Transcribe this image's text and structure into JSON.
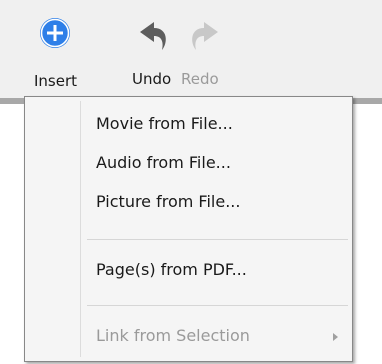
{
  "toolbar": {
    "insert": {
      "label": "Insert",
      "icon": "plus-circle-icon"
    },
    "undo": {
      "label": "Undo",
      "icon": "undo-icon"
    },
    "redo": {
      "label": "Redo",
      "icon": "redo-icon",
      "disabled": true
    }
  },
  "insert_menu": {
    "items": [
      {
        "label": "Movie from File..."
      },
      {
        "label": "Audio from File..."
      },
      {
        "label": "Picture from File..."
      },
      {
        "label": "Page(s) from PDF..."
      },
      {
        "label": "Link from Selection",
        "disabled": true,
        "has_submenu": true
      }
    ]
  },
  "colors": {
    "accent": "#2e7fe8",
    "toolbar_bg": "#f0f0f0",
    "menu_bg": "#f5f5f5",
    "disabled_text": "#9a9a9a"
  }
}
